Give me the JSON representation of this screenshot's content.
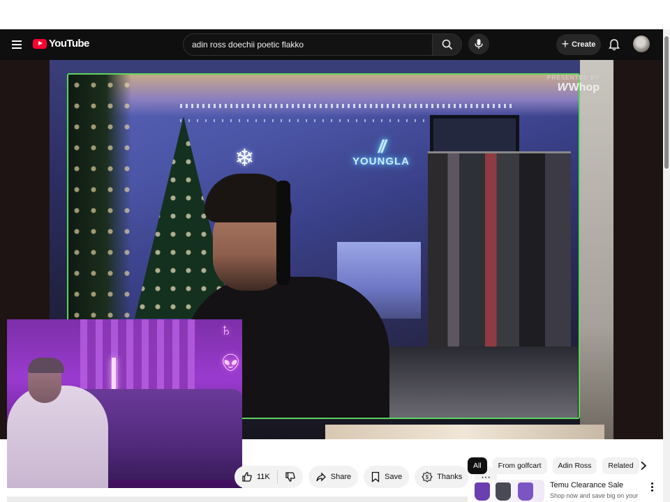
{
  "header": {
    "logo_text": "YouTube",
    "search_value": "adin ross doechii poetic flakko",
    "create_label": "Create"
  },
  "video": {
    "sponsor_label": "PRESENTED BY",
    "sponsor_brand": "Whop",
    "wall_logo_text": "YOUNGLA"
  },
  "actions": {
    "like_count": "11K",
    "share_label": "Share",
    "save_label": "Save",
    "thanks_label": "Thanks"
  },
  "chips": [
    "All",
    "From golfcart",
    "Adin Ross",
    "Related"
  ],
  "ad": {
    "title": "Temu Clearance Sale",
    "description": "Shop now and save big on your"
  },
  "icons": {
    "menu": "menu-icon",
    "search": "search-icon",
    "mic": "mic-icon",
    "bell": "bell-icon",
    "like": "thumbs-up-icon",
    "dislike": "thumbs-down-icon",
    "share": "share-icon",
    "save": "bookmark-icon",
    "thanks": "dollar-icon",
    "more": "more-horizontal-icon",
    "next": "chevron-right-icon"
  },
  "colors": {
    "brand_red": "#ff0033",
    "topbar_bg": "#0f0f0f",
    "cam_border": "#5cd65c"
  }
}
